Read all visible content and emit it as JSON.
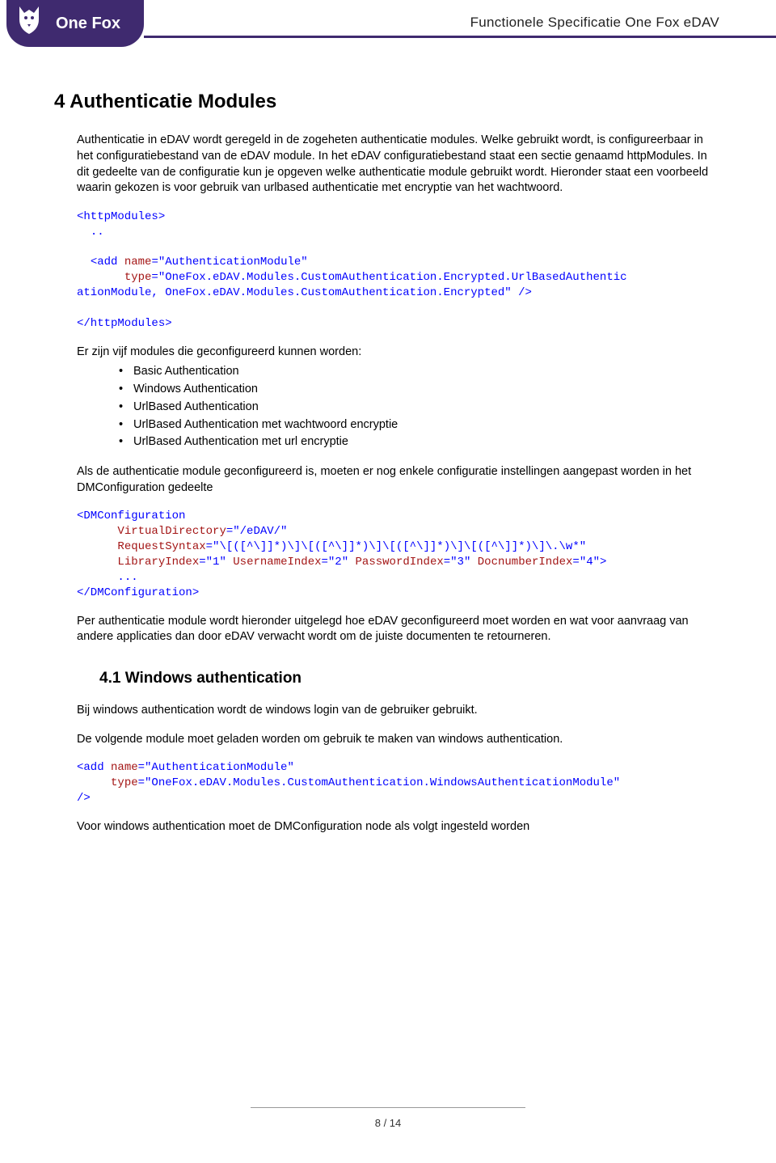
{
  "header": {
    "logo_text": "One Fox",
    "doc_title": "Functionele Specificatie One Fox eDAV"
  },
  "section": {
    "number": "4",
    "title": "Authenticatie Modules",
    "intro": "Authenticatie in eDAV wordt geregeld in de zogeheten authenticatie modules. Welke gebruikt wordt, is configureerbaar in het configuratiebestand van de eDAV module. In het eDAV configuratiebestand staat een sectie genaamd httpModules. In dit gedeelte van de configuratie kun je opgeven welke authenticatie module gebruikt wordt. Hieronder staat een voorbeeld waarin gekozen is voor gebruik van urlbased authenticatie met encryptie van het wachtwoord."
  },
  "code1": {
    "open_tag": "<httpModules>",
    "ellipsis": "..",
    "add_open": "<add",
    "name_attr": "name",
    "name_val": "\"AuthenticationModule\"",
    "type_attr": "type",
    "type_val_a": "\"OneFox.eDAV.Modules.CustomAuthentication.Encrypted.UrlBasedAuthentic",
    "type_val_b": "ationModule, OneFox.eDAV.Modules.CustomAuthentication.Encrypted\"",
    "close_self": " />",
    "close_tag": "</httpModules>"
  },
  "modules_intro": "Er zijn vijf modules die geconfigureerd kunnen worden:",
  "modules": [
    "Basic Authentication",
    "Windows Authentication",
    "UrlBased Authentication",
    "UrlBased Authentication met wachtwoord encryptie",
    "UrlBased Authentication met url encryptie"
  ],
  "config_note": "Als de authenticatie module geconfigureerd is, moeten er nog enkele configuratie instellingen aangepast worden in het DMConfiguration gedeelte",
  "code2": {
    "open": "<DMConfiguration",
    "vd_attr": "VirtualDirectory",
    "vd_val": "\"/eDAV/\"",
    "rs_attr": "RequestSyntax",
    "rs_val": "\"\\[([^\\]]*)\\]\\[([^\\]]*)\\]\\[([^\\]]*)\\]\\[([^\\]]*)\\]\\.\\w*\"",
    "li_attr": "LibraryIndex",
    "li_val": "\"1\"",
    "ui_attr": "UsernameIndex",
    "ui_val": "\"2\"",
    "pi_attr": "PasswordIndex",
    "pi_val": "\"3\"",
    "di_attr": "DocnumberIndex",
    "di_val": "\"4\"",
    "gt": ">",
    "ellipsis": "...",
    "close": "</DMConfiguration>"
  },
  "per_module": "Per authenticatie module wordt hieronder uitgelegd hoe eDAV geconfigureerd moet worden en wat voor aanvraag van andere applicaties dan door eDAV verwacht wordt om de juiste documenten te retourneren.",
  "sub": {
    "number": "4.1",
    "title": "Windows authentication",
    "p1": "Bij windows authentication wordt de windows login van de gebruiker gebruikt.",
    "p2": "De volgende module moet geladen worden om gebruik te maken van windows authentication."
  },
  "code3": {
    "add_open": "<add",
    "name_attr": "name",
    "name_val": "\"AuthenticationModule\"",
    "type_attr": "type",
    "type_val": "\"OneFox.eDAV.Modules.CustomAuthentication.WindowsAuthenticationModule\"",
    "close": "/>"
  },
  "sub_p3": "Voor windows authentication moet de DMConfiguration node als volgt ingesteld worden",
  "footer": "8 / 14"
}
